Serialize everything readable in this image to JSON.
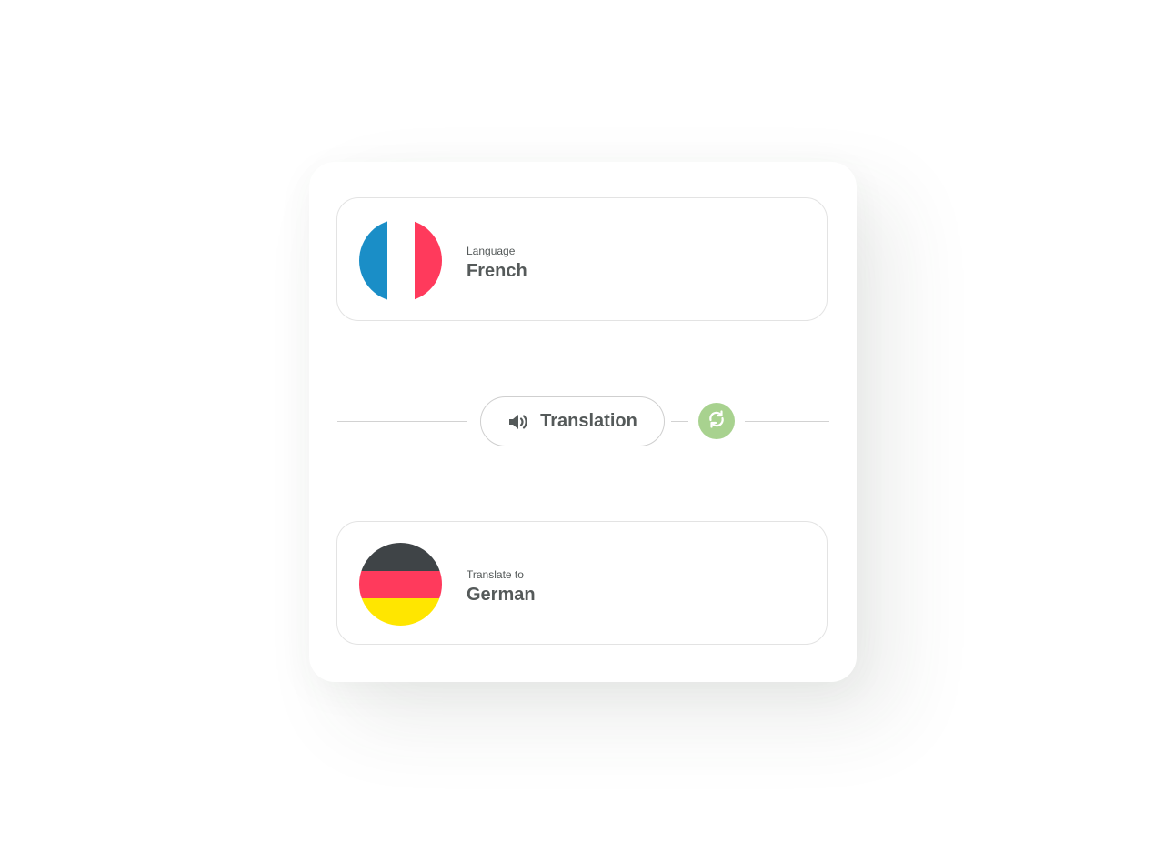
{
  "source": {
    "caption": "Language",
    "language": "French",
    "flag_icon": "france-flag-icon",
    "flag_colors": [
      "#1a8ec7",
      "#ffffff",
      "#ff3a5c"
    ]
  },
  "target": {
    "caption": "Translate to",
    "language": "German",
    "flag_icon": "germany-flag-icon",
    "flag_colors": [
      "#3f4447",
      "#ff3a5c",
      "#ffe600"
    ]
  },
  "translation_button": {
    "label": "Translation",
    "icon": "speaker-icon"
  },
  "swap_button": {
    "icon": "swap-icon",
    "color": "#a8d28f"
  },
  "theme": {
    "text_color": "#555a5a",
    "border_color": "#e3e3e3"
  }
}
